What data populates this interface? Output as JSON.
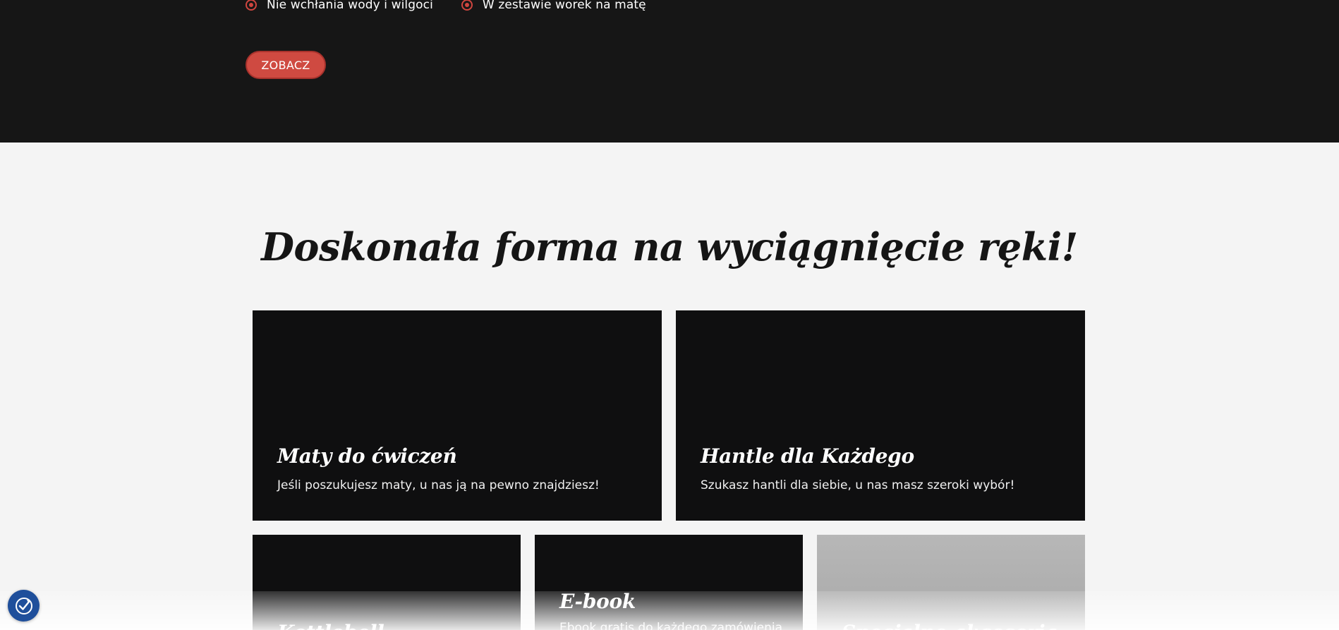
{
  "hero": {
    "features": [
      {
        "icon": "target-icon",
        "text": "Nie wchłania wody i wilgoci"
      },
      {
        "icon": "target-icon",
        "text": "W zestawie worek na matę"
      }
    ],
    "cta_label": "ZOBACZ",
    "accent_color": "#d0463f"
  },
  "section": {
    "title": "Doskonała forma na wyciągnięcie ręki!"
  },
  "cards": [
    {
      "title": "Maty do ćwiczeń",
      "desc": "Jeśli poszukujesz maty, u nas ją na pewno znajdziesz!"
    },
    {
      "title": "Hantle dla Każdego",
      "desc": "Szukasz hantli dla siebie, u nas masz szeroki wybór!"
    },
    {
      "title": "Kettlebell",
      "desc": ""
    },
    {
      "title": "E-book",
      "desc": "Ebook gratis do każdego zamówienia"
    },
    {
      "title": "Specjalne akcesoria",
      "desc": ""
    }
  ],
  "accessibility": {
    "icon": "accessibility-icon"
  }
}
